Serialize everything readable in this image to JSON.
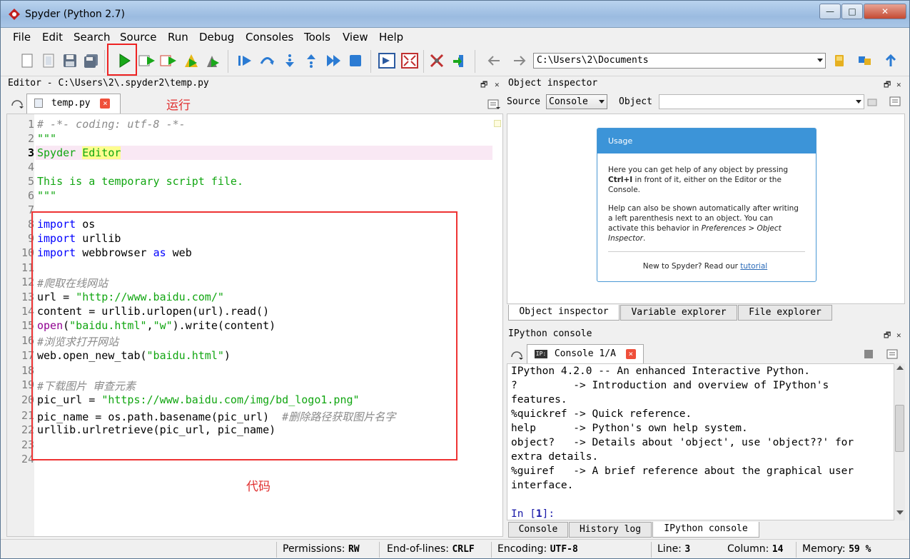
{
  "window": {
    "title": "Spyder (Python 2.7)",
    "controls": {
      "minimize": "—",
      "maximize": "□",
      "close": "✕"
    }
  },
  "menu": [
    "File",
    "Edit",
    "Search",
    "Source",
    "Run",
    "Debug",
    "Consoles",
    "Tools",
    "View",
    "Help"
  ],
  "toolbar": {
    "path": "C:\\Users\\2\\Documents"
  },
  "editor": {
    "header": "Editor - C:\\Users\\2\\.spyder2\\temp.py",
    "tab": "temp.py",
    "run_annotation": "运行",
    "code_annotation": "代码",
    "line_numbers": [
      "1",
      "2",
      "3",
      "4",
      "5",
      "6",
      "7",
      "8",
      "9",
      "10",
      "11",
      "12",
      "13",
      "14",
      "15",
      "16",
      "17",
      "18",
      "19",
      "20",
      "21",
      "22",
      "23",
      "24"
    ],
    "lines": {
      "l1": "# -*- coding: utf-8 -*-",
      "l2": "\"\"\"",
      "l3a": "Spyder ",
      "l3b": "Editor",
      "l5": "This is a temporary script file.",
      "l6": "\"\"\"",
      "l8kw": "import",
      "l8": " os",
      "l9kw": "import",
      "l9": " urllib",
      "l10kw": "import",
      "l10a": " webbrowser ",
      "l10as": "as",
      "l10b": " web",
      "l12": "#爬取在线网站",
      "l13a": "url = ",
      "l13s": "\"http://www.baidu.com/\"",
      "l14": "content = urllib.urlopen(url).read()",
      "l15bi": "open",
      "l15a": "(",
      "l15s1": "\"baidu.html\"",
      "l15b": ",",
      "l15s2": "\"w\"",
      "l15c": ").write(content)",
      "l16": "#浏览求打开网站",
      "l17a": "web.open_new_tab(",
      "l17s": "\"baidu.html\"",
      "l17b": ")",
      "l19": "#下载图片 审查元素",
      "l20a": "pic_url = ",
      "l20s": "\"https://www.baidu.com/img/bd_logo1.png\"",
      "l21a": "pic_name = os.path.basename(pic_url)  ",
      "l21c": "#删除路径获取图片名字",
      "l22": "urllib.urlretrieve(pic_url, pic_name)"
    }
  },
  "object_inspector": {
    "header": "Object inspector",
    "source_label": "Source",
    "source_value": "Console",
    "object_label": "Object",
    "usage_title": "Usage",
    "p1a": "Here you can get help of any object by pressing",
    "p1b": "Ctrl+I",
    "p1c": " in front of it, either on the Editor or the Console.",
    "p2a": "Help can also be shown automatically after writing a left parenthesis next to an object. You can activate this behavior in ",
    "p2b": "Preferences > Object Inspector",
    "p2c": ".",
    "p3a": "New to Spyder? Read our ",
    "p3b": "tutorial",
    "tabs": [
      "Object inspector",
      "Variable explorer",
      "File explorer"
    ]
  },
  "ipython": {
    "header": "IPython console",
    "tab": "Console 1/A",
    "lines": [
      "IPython 4.2.0 -- An enhanced Interactive Python.",
      "?         -> Introduction and overview of IPython's",
      "features.",
      "%quickref -> Quick reference.",
      "help      -> Python's own help system.",
      "object?   -> Details about 'object', use 'object??' for",
      "extra details.",
      "%guiref   -> A brief reference about the graphical user",
      "interface."
    ],
    "prompt_a": "In [",
    "prompt_n": "1",
    "prompt_b": "]:",
    "tabs": [
      "Console",
      "History log",
      "IPython console"
    ]
  },
  "status": {
    "permissions_label": "Permissions:",
    "permissions": "RW",
    "eol_label": "End-of-lines:",
    "eol": "CRLF",
    "encoding_label": "Encoding:",
    "encoding": "UTF-8",
    "line_label": "Line:",
    "line": "3",
    "column_label": "Column:",
    "column": "14",
    "memory_label": "Memory:",
    "memory": "59 %"
  }
}
